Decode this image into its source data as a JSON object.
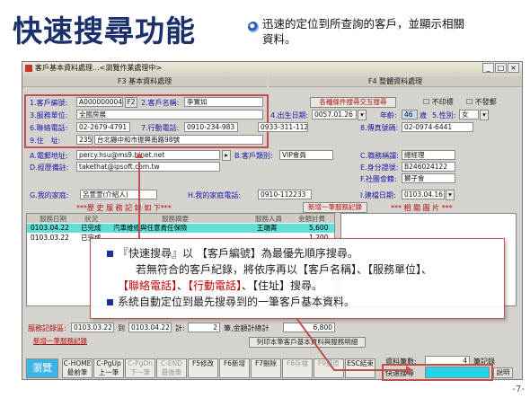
{
  "slide": {
    "title": "快速搜尋功能",
    "intro": "迅速的定位到所查詢的客戶，並顯示相關資料。",
    "page_number": "-7-"
  },
  "window": {
    "title": "客戶基本資料處理...<瀏覽作業處理中>",
    "tab_left": "F3 基本資料處理",
    "tab_right": "F4 整體資料處理"
  },
  "form": {
    "customer_id_label": "1.客戶編號:",
    "customer_id": "A000000004",
    "f2_button": "F2",
    "customer_name_label": "2.客戶名稱:",
    "customer_name": "李實如",
    "search_condition_button": "各種條件搜尋交互搜尋",
    "not_receive": "不印標",
    "not_query": "不發郵",
    "unit_label": "3.服務單位:",
    "unit": "全國房展",
    "birthday_label": "4.出生日期:",
    "birthday": "0057.01.26",
    "age_label": "年齡:",
    "age": "46",
    "age_unit": "歲",
    "gender_label": "5.性別:",
    "gender": "女",
    "phone_label": "6.聯絡電話:",
    "phone": "02-2679-4791",
    "mobile_label": "7.行動電話:",
    "mobile": "0910-234-983",
    "mobile2": "0933-311-112",
    "fax_label": "8.傳真號碼:",
    "fax": "02-0974-6441",
    "addr_label": "9.住　址:",
    "zip": "235",
    "address": "台北縣中和市振興南路98號",
    "email_label": "A.電郵地址:",
    "email": "percy.hsu@ms9.hinet.net",
    "cust_type_label": "B.客戶類別:",
    "cust_type": "VIP會員",
    "job_label": "C.職務稱謂:",
    "job": "總經理",
    "web_label": "D.經歷備註:",
    "web": "takethat@ipsoft.com.tw",
    "id_label": "E.身分證號:",
    "id_no": "B246024122",
    "assoc_label": "F.社團會籍:",
    "assoc": "獅子會",
    "family_label": "G.我的家庭:",
    "family": "呂萱萱(介紹人)",
    "home_phone_label": "H.我的家庭電話:",
    "home_phone": "0910-112233",
    "create_date_label": "I.建檔日期:",
    "create_date": "0103.04.16"
  },
  "history": {
    "header": "***歷 史 服 務 記 錄 如 下***",
    "new_record_button": "新增一筆服務記錄",
    "photo_header": "*** 相 關 圖 片 ***",
    "columns": [
      "服務日期",
      "狀況",
      "服務摘要",
      "服務人員",
      "金額計費"
    ],
    "rows": [
      {
        "date": "0103.04.22",
        "status": "已完成",
        "summary": "汽車維修與任意責任保險",
        "staff": "王瑞菁",
        "amount": "5,600"
      },
      {
        "date": "0103.03.22",
        "status": "已完成",
        "summary": "",
        "staff": "",
        "amount": "1,200"
      }
    ]
  },
  "callout": {
    "line1": "『快速搜尋』以 【客戶編號】為最優先順序搜尋。",
    "line2_a": "若無符合的客戶紀錄，將依序再以【客戶名稱】、【服務單位】、",
    "line3_a": "【聯絡電話】",
    "line3_b": "、",
    "line3_c": "【行動電話】",
    "line3_d": "、【住址】搜尋。",
    "line4": "系統自動定位到最先搜尋到的一筆客戶基本資料。"
  },
  "footer": {
    "date_range_label": "服務記錄區:",
    "date_from": "0103.03.22",
    "to_label": "到",
    "date_to": "0103.04.22",
    "total_label": "計:",
    "count": "2",
    "count_unit": "筆,金額計總計",
    "total": "6,800",
    "add_button": "新增一筆服務記錄",
    "print_button": "列印本筆客戶基本資料與服務明細",
    "record_total_label": "資料筆數:",
    "record_total": "4",
    "record_unit": "筆記錄",
    "quick_search_label": "快速搜尋",
    "quick_search_value": "",
    "help_button": "說明"
  },
  "toolbar": [
    {
      "label": "瀏覽",
      "name": "browse-button",
      "disabled": false
    },
    {
      "label": "C-HOME\n最前筆",
      "name": "first-record-button",
      "disabled": false
    },
    {
      "label": "C-PgUp\n上一筆",
      "name": "prev-record-button",
      "disabled": false
    },
    {
      "label": "C-PgDn\n下一筆",
      "name": "next-record-button",
      "disabled": true
    },
    {
      "label": "C-END\n最後筆",
      "name": "last-record-button",
      "disabled": true
    },
    {
      "label": "F5修改",
      "name": "edit-button",
      "disabled": false
    },
    {
      "label": "F6新增",
      "name": "add-button",
      "disabled": false
    },
    {
      "label": "F7刪除",
      "name": "delete-button",
      "disabled": false
    },
    {
      "label": "F8存檔",
      "name": "save-button",
      "disabled": true
    },
    {
      "label": "F9還原",
      "name": "restore-button",
      "disabled": true
    },
    {
      "label": "ESC結束",
      "name": "exit-button",
      "disabled": false
    }
  ]
}
